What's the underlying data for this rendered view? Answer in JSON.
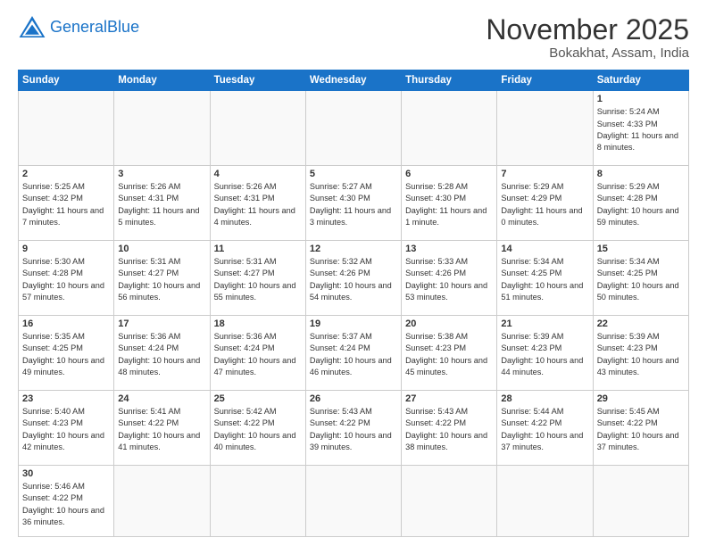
{
  "header": {
    "logo_general": "General",
    "logo_blue": "Blue",
    "month": "November 2025",
    "location": "Bokakhat, Assam, India"
  },
  "days_of_week": [
    "Sunday",
    "Monday",
    "Tuesday",
    "Wednesday",
    "Thursday",
    "Friday",
    "Saturday"
  ],
  "weeks": [
    [
      {
        "day": "",
        "info": ""
      },
      {
        "day": "",
        "info": ""
      },
      {
        "day": "",
        "info": ""
      },
      {
        "day": "",
        "info": ""
      },
      {
        "day": "",
        "info": ""
      },
      {
        "day": "",
        "info": ""
      },
      {
        "day": "1",
        "info": "Sunrise: 5:24 AM\nSunset: 4:33 PM\nDaylight: 11 hours and 8 minutes."
      }
    ],
    [
      {
        "day": "2",
        "info": "Sunrise: 5:25 AM\nSunset: 4:32 PM\nDaylight: 11 hours and 7 minutes."
      },
      {
        "day": "3",
        "info": "Sunrise: 5:26 AM\nSunset: 4:31 PM\nDaylight: 11 hours and 5 minutes."
      },
      {
        "day": "4",
        "info": "Sunrise: 5:26 AM\nSunset: 4:31 PM\nDaylight: 11 hours and 4 minutes."
      },
      {
        "day": "5",
        "info": "Sunrise: 5:27 AM\nSunset: 4:30 PM\nDaylight: 11 hours and 3 minutes."
      },
      {
        "day": "6",
        "info": "Sunrise: 5:28 AM\nSunset: 4:30 PM\nDaylight: 11 hours and 1 minute."
      },
      {
        "day": "7",
        "info": "Sunrise: 5:29 AM\nSunset: 4:29 PM\nDaylight: 11 hours and 0 minutes."
      },
      {
        "day": "8",
        "info": "Sunrise: 5:29 AM\nSunset: 4:28 PM\nDaylight: 10 hours and 59 minutes."
      }
    ],
    [
      {
        "day": "9",
        "info": "Sunrise: 5:30 AM\nSunset: 4:28 PM\nDaylight: 10 hours and 57 minutes."
      },
      {
        "day": "10",
        "info": "Sunrise: 5:31 AM\nSunset: 4:27 PM\nDaylight: 10 hours and 56 minutes."
      },
      {
        "day": "11",
        "info": "Sunrise: 5:31 AM\nSunset: 4:27 PM\nDaylight: 10 hours and 55 minutes."
      },
      {
        "day": "12",
        "info": "Sunrise: 5:32 AM\nSunset: 4:26 PM\nDaylight: 10 hours and 54 minutes."
      },
      {
        "day": "13",
        "info": "Sunrise: 5:33 AM\nSunset: 4:26 PM\nDaylight: 10 hours and 53 minutes."
      },
      {
        "day": "14",
        "info": "Sunrise: 5:34 AM\nSunset: 4:25 PM\nDaylight: 10 hours and 51 minutes."
      },
      {
        "day": "15",
        "info": "Sunrise: 5:34 AM\nSunset: 4:25 PM\nDaylight: 10 hours and 50 minutes."
      }
    ],
    [
      {
        "day": "16",
        "info": "Sunrise: 5:35 AM\nSunset: 4:25 PM\nDaylight: 10 hours and 49 minutes."
      },
      {
        "day": "17",
        "info": "Sunrise: 5:36 AM\nSunset: 4:24 PM\nDaylight: 10 hours and 48 minutes."
      },
      {
        "day": "18",
        "info": "Sunrise: 5:36 AM\nSunset: 4:24 PM\nDaylight: 10 hours and 47 minutes."
      },
      {
        "day": "19",
        "info": "Sunrise: 5:37 AM\nSunset: 4:24 PM\nDaylight: 10 hours and 46 minutes."
      },
      {
        "day": "20",
        "info": "Sunrise: 5:38 AM\nSunset: 4:23 PM\nDaylight: 10 hours and 45 minutes."
      },
      {
        "day": "21",
        "info": "Sunrise: 5:39 AM\nSunset: 4:23 PM\nDaylight: 10 hours and 44 minutes."
      },
      {
        "day": "22",
        "info": "Sunrise: 5:39 AM\nSunset: 4:23 PM\nDaylight: 10 hours and 43 minutes."
      }
    ],
    [
      {
        "day": "23",
        "info": "Sunrise: 5:40 AM\nSunset: 4:23 PM\nDaylight: 10 hours and 42 minutes."
      },
      {
        "day": "24",
        "info": "Sunrise: 5:41 AM\nSunset: 4:22 PM\nDaylight: 10 hours and 41 minutes."
      },
      {
        "day": "25",
        "info": "Sunrise: 5:42 AM\nSunset: 4:22 PM\nDaylight: 10 hours and 40 minutes."
      },
      {
        "day": "26",
        "info": "Sunrise: 5:43 AM\nSunset: 4:22 PM\nDaylight: 10 hours and 39 minutes."
      },
      {
        "day": "27",
        "info": "Sunrise: 5:43 AM\nSunset: 4:22 PM\nDaylight: 10 hours and 38 minutes."
      },
      {
        "day": "28",
        "info": "Sunrise: 5:44 AM\nSunset: 4:22 PM\nDaylight: 10 hours and 37 minutes."
      },
      {
        "day": "29",
        "info": "Sunrise: 5:45 AM\nSunset: 4:22 PM\nDaylight: 10 hours and 37 minutes."
      }
    ],
    [
      {
        "day": "30",
        "info": "Sunrise: 5:46 AM\nSunset: 4:22 PM\nDaylight: 10 hours and 36 minutes."
      },
      {
        "day": "",
        "info": ""
      },
      {
        "day": "",
        "info": ""
      },
      {
        "day": "",
        "info": ""
      },
      {
        "day": "",
        "info": ""
      },
      {
        "day": "",
        "info": ""
      },
      {
        "day": "",
        "info": ""
      }
    ]
  ]
}
